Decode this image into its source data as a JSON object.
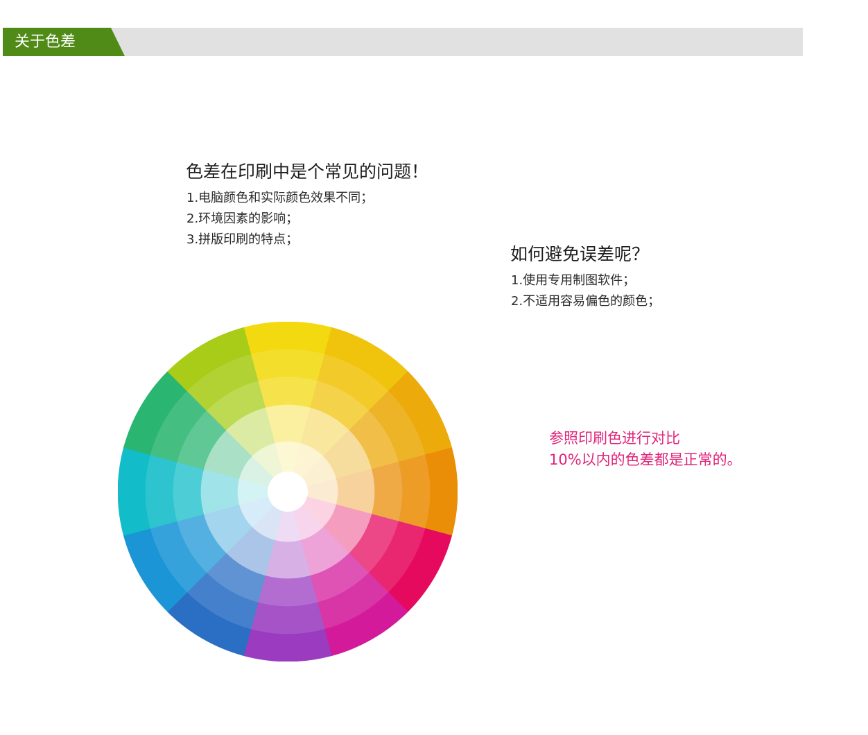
{
  "header": {
    "title": "关于色差",
    "accent_color": "#4f8b16",
    "bar_color": "#e1e1e1"
  },
  "problem": {
    "title": "色差在印刷中是个常见的问题！",
    "items": [
      "1.电脑颜色和实际颜色效果不同；",
      "2.环境因素的影响；",
      "3.拼版印刷的特点；"
    ]
  },
  "solution": {
    "title": "如何避免误差呢？",
    "items": [
      "1.使用专用制图软件；",
      "2.不适用容易偏色的颜色；"
    ]
  },
  "note": {
    "lines": [
      "参照印刷色进行对比",
      "10%以内的色差都是正常的。"
    ],
    "color": "#e0257a"
  },
  "color_wheel": {
    "hues": [
      "#f3d90f",
      "#f0c40d",
      "#ecaa0b",
      "#ea8e08",
      "#e60a5e",
      "#d31a9a",
      "#9a3bc0",
      "#2a6fc4",
      "#1b95d6",
      "#12bcc8",
      "#2ab570",
      "#a8cc18"
    ]
  }
}
